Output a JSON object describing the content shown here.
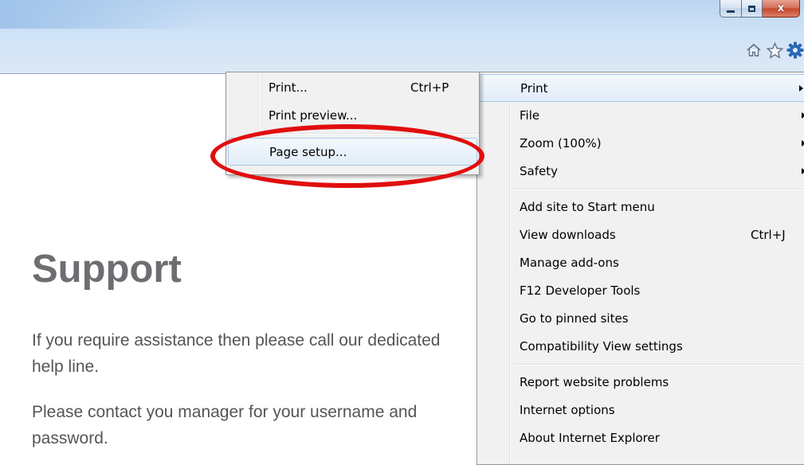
{
  "window": {
    "buttons": {
      "minimize_icon": "minimize-icon",
      "maximize_icon": "restore-icon",
      "close_label": "x"
    },
    "toolbar": {
      "icons": [
        "home-icon",
        "favorites-star-icon",
        "tools-gear-icon"
      ]
    }
  },
  "tools_menu": {
    "items": [
      {
        "label": "Print",
        "submenu": true,
        "highlighted": true
      },
      {
        "label": "File",
        "submenu": true
      },
      {
        "label": "Zoom (100%)",
        "submenu": true
      },
      {
        "label": "Safety",
        "submenu": true
      },
      {
        "label": "Add site to Start menu"
      },
      {
        "label": "View downloads",
        "shortcut": "Ctrl+J"
      },
      {
        "label": "Manage add-ons"
      },
      {
        "label": "F12 Developer Tools"
      },
      {
        "label": "Go to pinned sites"
      },
      {
        "label": "Compatibility View settings"
      },
      {
        "label": "Report website problems"
      },
      {
        "label": "Internet options"
      },
      {
        "label": "About Internet Explorer"
      }
    ]
  },
  "print_submenu": {
    "items": [
      {
        "label": "Print...",
        "shortcut": "Ctrl+P"
      },
      {
        "label": "Print preview..."
      },
      {
        "label": "Page setup...",
        "highlighted": true
      }
    ]
  },
  "page": {
    "heading": "Support",
    "paragraph1": "If you require assistance then please call our dedicated help line.",
    "paragraph2": "Please contact you manager for your username and password."
  },
  "colors": {
    "highlight_circle": "#e10e0e",
    "heading": "#6d6e71",
    "body_text": "#555555",
    "menu_background": "#f1f1f1"
  }
}
